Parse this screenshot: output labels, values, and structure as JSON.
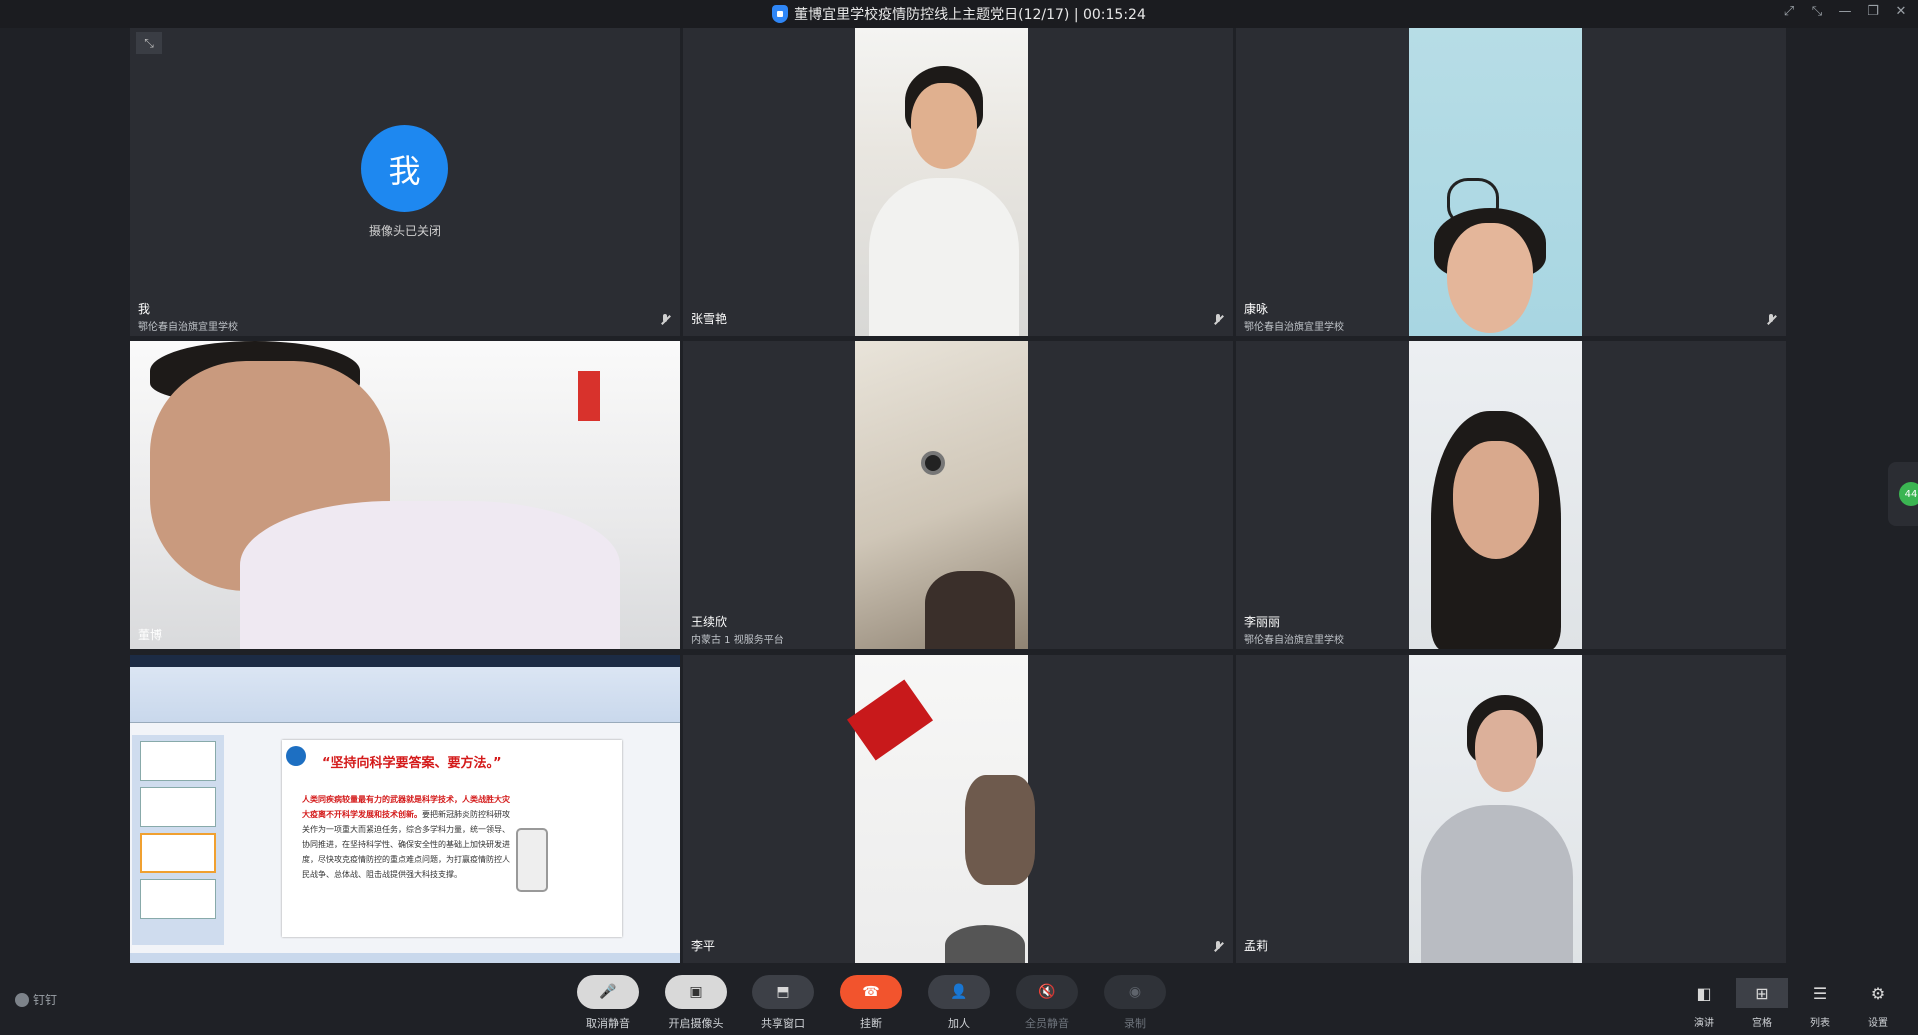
{
  "window": {
    "title": "董博宜里学校疫情防控线上主题党日(12/17) | 00:15:24",
    "controls": [
      "⤢",
      "⤡",
      "—",
      "❐",
      "✕"
    ]
  },
  "tiles": {
    "me": {
      "avatar": "我",
      "status": "摄像头已关闭",
      "name": "我",
      "org": "鄂伦春自治旗宜里学校"
    },
    "t2": {
      "name": "张雪艳",
      "org": ""
    },
    "t3": {
      "name": "康咏",
      "org": "鄂伦春自治旗宜里学校"
    },
    "t4": {
      "name": "董博",
      "org": ""
    },
    "t5": {
      "name": "王续欣",
      "org": "内蒙古 1 视服务平台"
    },
    "t6": {
      "name": "李丽丽",
      "org": "鄂伦春自治旗宜里学校"
    },
    "t8": {
      "name": "李平",
      "org": ""
    },
    "t9": {
      "name": "孟莉",
      "org": ""
    }
  },
  "shared_slide": {
    "title": "“坚持向科学要答案、要方法。”",
    "highlight": "人类同疾病较量最有力的武器就是科学技术，人类战胜大灾大疫离不开科学发展和技术创新。",
    "body": "要把新冠肺炎防控科研攻关作为一项重大而紧迫任务，综合多学科力量，统一领导、协同推进，在坚持科学性、确保安全性的基础上加快研发进度，尽快攻克疫情防控的重点难点问题，为打赢疫情防控人民战争、总体战、阻击战提供强大科技支撑。"
  },
  "toolbar": {
    "brand": "钉钉",
    "buttons": [
      {
        "icon": "🎤",
        "label": "取消静音"
      },
      {
        "icon": "▣",
        "label": "开启摄像头"
      },
      {
        "icon": "⬒",
        "label": "共享窗口"
      },
      {
        "icon": "☎",
        "label": "挂断"
      },
      {
        "icon": "👤",
        "label": "加人"
      },
      {
        "icon": "🔇",
        "label": "全员静音"
      },
      {
        "icon": "◉",
        "label": "录制"
      }
    ],
    "views": [
      {
        "icon": "◧",
        "label": "演讲"
      },
      {
        "icon": "⊞",
        "label": "宫格"
      },
      {
        "icon": "☰",
        "label": "列表"
      },
      {
        "icon": "⚙",
        "label": "设置"
      }
    ]
  },
  "side_handle": {
    "label": "44"
  },
  "colors": {
    "accent": "#1e88f0",
    "hangup": "#f2542d",
    "bg": "#1f2126",
    "tile": "#2b2d33"
  }
}
